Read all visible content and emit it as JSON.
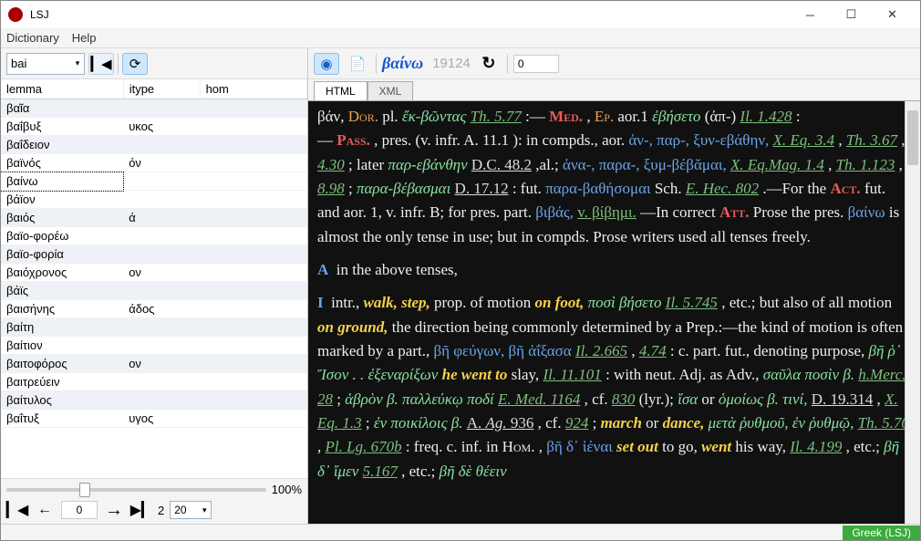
{
  "window": {
    "title": "LSJ"
  },
  "menu": [
    "Dictionary",
    "Help"
  ],
  "left": {
    "search": "bai",
    "columns": [
      "lemma",
      "itype",
      "hom"
    ],
    "rows": [
      {
        "lemma": "βαῖα",
        "itype": "",
        "hom": ""
      },
      {
        "lemma": "βαΐβυξ",
        "itype": "υκος",
        "hom": ""
      },
      {
        "lemma": "βαΐδειον",
        "itype": "",
        "hom": ""
      },
      {
        "lemma": "βαϊνός",
        "itype": "όν",
        "hom": ""
      },
      {
        "lemma": "βαίνω",
        "itype": "",
        "hom": ""
      },
      {
        "lemma": "βάϊον",
        "itype": "",
        "hom": ""
      },
      {
        "lemma": "βαιός",
        "itype": "ά",
        "hom": ""
      },
      {
        "lemma": "βαϊο-φορέω",
        "itype": "",
        "hom": ""
      },
      {
        "lemma": "βαϊο-φορία",
        "itype": "",
        "hom": ""
      },
      {
        "lemma": "βαιόχρονος",
        "itype": "ον",
        "hom": ""
      },
      {
        "lemma": "βάϊς",
        "itype": "",
        "hom": ""
      },
      {
        "lemma": "βαισήνης",
        "itype": "άδος",
        "hom": ""
      },
      {
        "lemma": "βαίτη",
        "itype": "",
        "hom": ""
      },
      {
        "lemma": "βαίτιον",
        "itype": "",
        "hom": ""
      },
      {
        "lemma": "βαιτοφόρος",
        "itype": "ον",
        "hom": ""
      },
      {
        "lemma": "βαιτρεύειν",
        "itype": "",
        "hom": ""
      },
      {
        "lemma": "βαίτυλος",
        "itype": "",
        "hom": ""
      },
      {
        "lemma": "βαΐτυξ",
        "itype": "υγος",
        "hom": ""
      }
    ],
    "cur_index": 4,
    "zoom": "100%",
    "page_cur": "0",
    "page_total": "2",
    "page_size": "20"
  },
  "right": {
    "entry_word": "βαίνω",
    "entry_id": "19124",
    "counter": "0",
    "tabs": [
      "HTML",
      "XML"
    ]
  },
  "status": {
    "lang": "Greek (LSJ)"
  }
}
